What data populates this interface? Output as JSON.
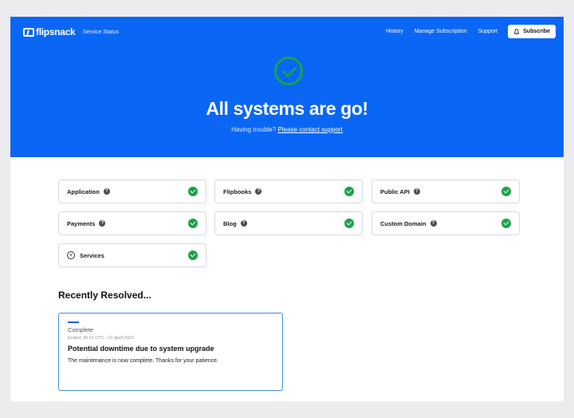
{
  "header": {
    "brand": "flipsnack",
    "service_status": "Service Status",
    "nav": [
      "History",
      "Manage Subscription",
      "Support"
    ],
    "subscribe_label": "Subscribe"
  },
  "hero": {
    "title": "All systems are go!",
    "trouble_text": "Having trouble?",
    "contact_link": "Please contact support"
  },
  "components": [
    {
      "name": "Application",
      "status": "operational"
    },
    {
      "name": "Flipbooks",
      "status": "operational"
    },
    {
      "name": "Public API",
      "status": "operational"
    },
    {
      "name": "Payments",
      "status": "operational"
    },
    {
      "name": "Blog",
      "status": "operational"
    },
    {
      "name": "Custom Domain",
      "status": "operational"
    },
    {
      "name": "Services",
      "status": "operational"
    }
  ],
  "recently_resolved": {
    "heading": "Recently Resolved...",
    "incident": {
      "status": "Complete",
      "ended": "Ended: 06:51 UTC - 21 April 2023",
      "title": "Potential downtime due to system upgrade",
      "body": "The maintenance is now complete. Thanks for your patience."
    }
  },
  "colors": {
    "brand_blue": "#0a66f5",
    "success_green": "#18a34a",
    "accent_border": "#4b87e8"
  }
}
